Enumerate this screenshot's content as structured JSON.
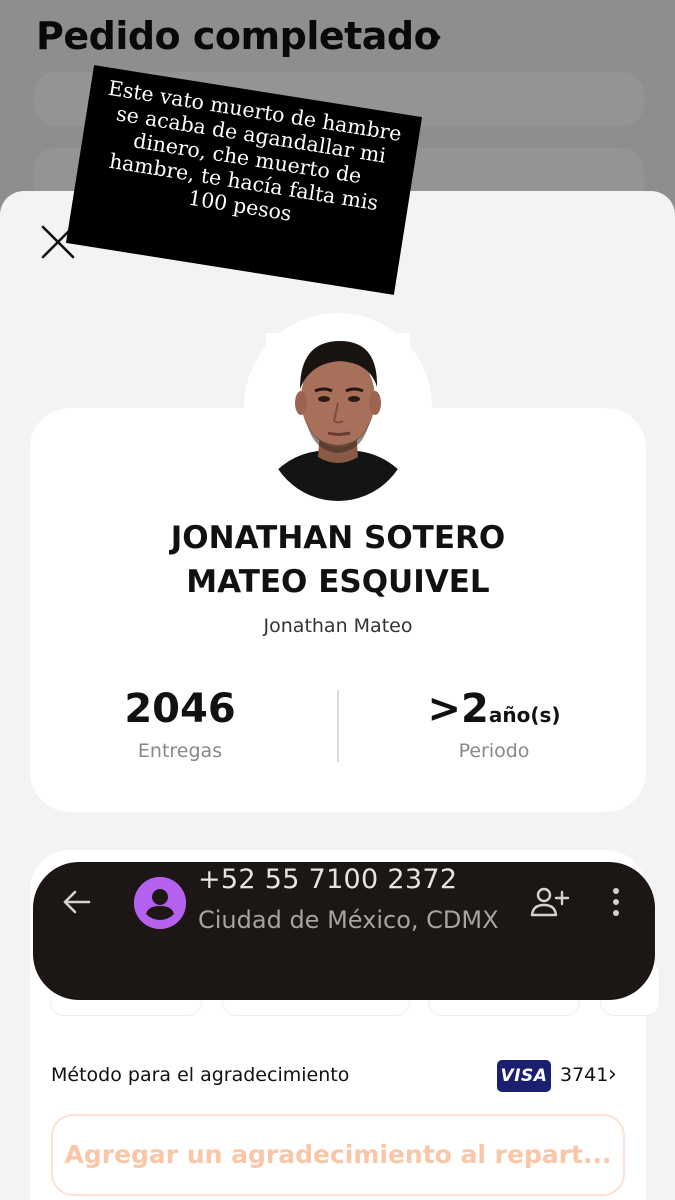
{
  "background": {
    "title": "Pedido completado"
  },
  "caption": {
    "text": "Este vato muerto de hambre se acaba de agandallar mi dinero, che muerto de hambre, te hacía falta mis 100 pesos"
  },
  "courier": {
    "full_name_line1": "JONATHAN SOTERO",
    "full_name_line2": "MATEO ESQUIVEL",
    "nickname": "Jonathan Mateo",
    "deliveries_value": "2046",
    "deliveries_label": "Entregas",
    "period_prefix": ">2",
    "period_unit": "año(s)",
    "period_label": "Periodo"
  },
  "contact": {
    "phone": "+52 55 7100 2372",
    "location": "Ciudad de México, CDMX"
  },
  "payment": {
    "method_label": "Método para el agradecimiento",
    "card_brand": "VISA",
    "card_last4": "3741"
  },
  "tip_button": {
    "label": "Agregar un agradecimiento al repart..."
  },
  "colors": {
    "sheet": "#f3f3f5",
    "contact_bar": "#1c1714",
    "contact_avatar": "#b660f0",
    "visa": "#1a1f71",
    "tip_text": "#f9c7a8"
  }
}
